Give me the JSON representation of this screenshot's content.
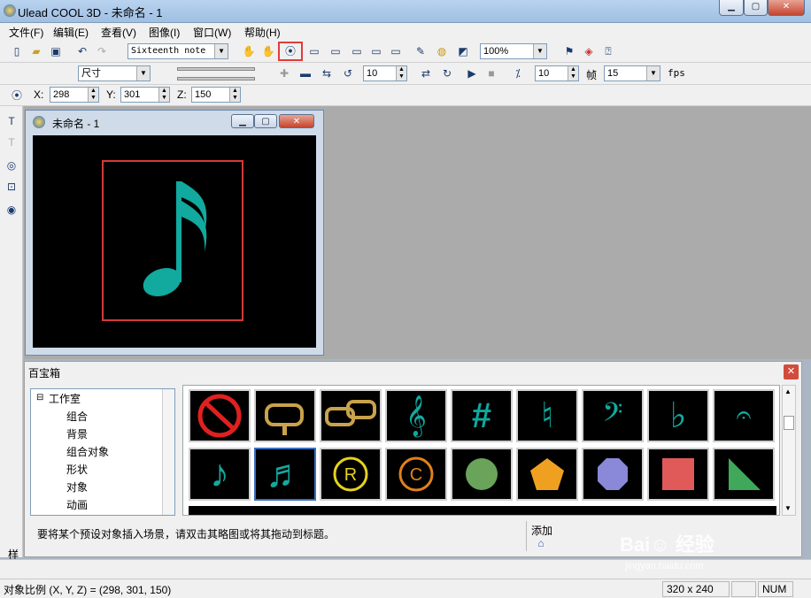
{
  "app": {
    "title": "Ulead COOL 3D - 未命名 - 1"
  },
  "menu": [
    "文件(F)",
    "编辑(E)",
    "查看(V)",
    "图像(I)",
    "窗口(W)",
    "帮助(H)"
  ],
  "toolbar1": {
    "object_combo": "Sixteenth note",
    "zoom_combo": "100%"
  },
  "toolbar2": {
    "property_combo": "尺寸",
    "step_value": "10",
    "frame_spin": "10",
    "frame_label": "帧",
    "fps_value": "15",
    "fps_label": "fps"
  },
  "coords": {
    "x_label": "X:",
    "x": "298",
    "y_label": "Y:",
    "y": "301",
    "z_label": "Z:",
    "z": "150"
  },
  "doc": {
    "title": "未命名 - 1"
  },
  "panel": {
    "title": "百宝箱",
    "tree_root": "工作室",
    "tree_items": [
      "组合",
      "背景",
      "组合对象",
      "形状",
      "对象",
      "动画"
    ],
    "hint": "要将某个预设对象插入场景，请双击其略图或将其拖动到标题。",
    "add_label": "添加",
    "thumbs_row1": [
      "no-smoking",
      "mailbox",
      "mailboxes",
      "treble-clef",
      "sharp",
      "natural",
      "bass-clef",
      "flat",
      "fermata"
    ],
    "thumbs_row2": [
      "eighth-note",
      "sixteenth-note",
      "registered",
      "copyright",
      "circle",
      "pentagon",
      "octagon",
      "square",
      "triangle"
    ]
  },
  "left_tab": "样",
  "status": {
    "text": "对象比例 (X, Y, Z) = (298, 301, 150)",
    "size": "320 x 240",
    "num": "NUM"
  },
  "colors": {
    "teal": "#12a99e",
    "gold": "#c9a24b",
    "orange": "#f0a020",
    "red_box": "#d43a3a"
  }
}
